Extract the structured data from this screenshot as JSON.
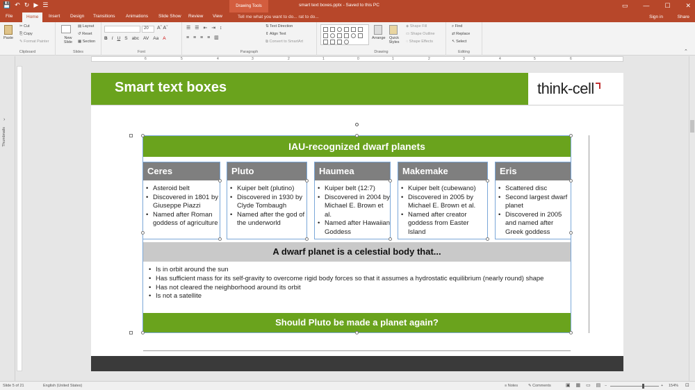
{
  "titlebar": {
    "quick_access": [
      "💾",
      "↶",
      "↻",
      "▶",
      "☰"
    ],
    "context_tab": "Drawing Tools",
    "doc_title": "smart text boxes.pptx - Saved to this PC",
    "win_buttons": [
      "▭",
      "—",
      "☐",
      "✕"
    ]
  },
  "tabs": {
    "items": [
      "File",
      "Home",
      "Insert",
      "Design",
      "Transitions",
      "Animations",
      "Slide Show",
      "Review",
      "View"
    ],
    "active": "Home",
    "tell_me": "Tell me what you want to do...",
    "tell_me_suffix": "rat to do...",
    "sign_in": "Sign in",
    "share": "Share"
  },
  "ribbon": {
    "clipboard": {
      "name": "Clipboard",
      "paste": "Paste",
      "cut": "Cut",
      "copy": "Copy",
      "format_painter": "Format Painter"
    },
    "slides": {
      "name": "Slides",
      "new_slide": "New Slide",
      "layout": "Layout",
      "reset": "Reset",
      "section": "Section"
    },
    "font": {
      "name": "Font",
      "font_size": "20",
      "buttons": [
        "B",
        "I",
        "U",
        "S",
        "abc",
        "AV",
        "Aa",
        "A"
      ]
    },
    "paragraph": {
      "name": "Paragraph",
      "text_direction": "Text Direction",
      "align_text": "Align Text",
      "convert_smartart": "Convert to SmartArt"
    },
    "drawing": {
      "name": "Drawing",
      "arrange": "Arrange",
      "quick_styles": "Quick Styles",
      "shape_fill": "Shape Fill",
      "shape_outline": "Shape Outline",
      "shape_effects": "Shape Effects"
    },
    "editing": {
      "name": "Editing",
      "find": "Find",
      "replace": "Replace",
      "select": "Select"
    }
  },
  "ruler_marks": [
    "6",
    "5",
    "4",
    "3",
    "2",
    "1",
    "0",
    "1",
    "2",
    "3",
    "4",
    "5",
    "6"
  ],
  "thumbnails_label": "Thumbnails",
  "slide": {
    "title": "Smart text boxes",
    "logo": "think-cell",
    "top_bar": "IAU-recognized dwarf planets",
    "columns": [
      {
        "name": "Ceres",
        "bullets": [
          "Asteroid belt",
          "Discovered in 1801 by Giuseppe Piazzi",
          "Named after Roman goddess of agriculture"
        ]
      },
      {
        "name": "Pluto",
        "bullets": [
          "Kuiper belt (plutino)",
          "Discovered in 1930 by Clyde Tombaugh",
          "Named after the god of the underworld"
        ]
      },
      {
        "name": "Haumea",
        "bullets": [
          "Kuiper belt (12:7)",
          "Discovered in 2004 by Michael E. Brown et al.",
          "Named after Hawaiian Goddess"
        ]
      },
      {
        "name": "Makemake",
        "bullets": [
          "Kuiper belt (cubewano)",
          "Discovered in 2005 by Michael E. Brown et al.",
          "Named after creator goddess from Easter Island"
        ]
      },
      {
        "name": "Eris",
        "bullets": [
          "Scattered disc",
          "Second largest dwarf planet",
          "Discovered in 2005 and named after Greek goddess"
        ]
      }
    ],
    "def_heading": "A dwarf planet is a celestial body that...",
    "def_bullets": [
      "Is in orbit around the sun",
      "Has sufficient mass for its self-gravity to overcome rigid body forces so that it assumes a hydrostatic equilibrium (nearly round) shape",
      "Has not cleared the neighborhood around its orbit",
      "Is not a satellite"
    ],
    "bottom_bar": "Should Pluto be made a planet again?"
  },
  "status": {
    "slide_of": "Slide 5 of 21",
    "language": "English (United States)",
    "notes": "Notes",
    "comments": "Comments",
    "zoom": "154%"
  }
}
